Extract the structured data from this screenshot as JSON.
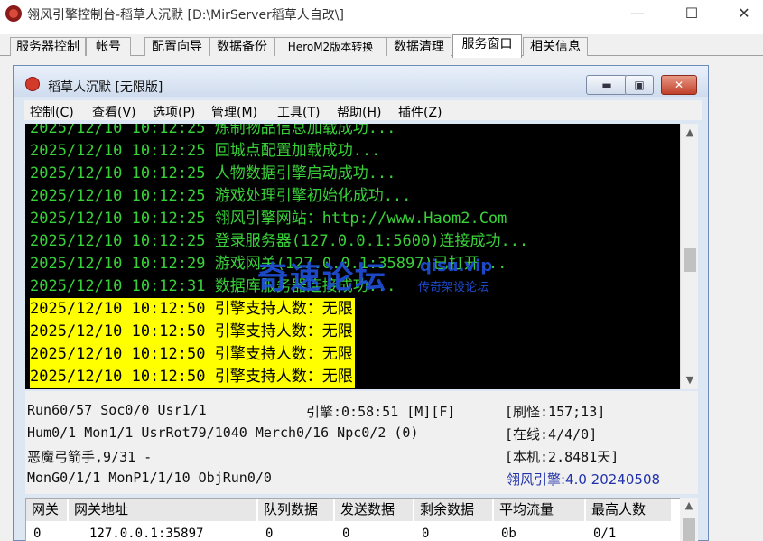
{
  "window": {
    "title": "翎风引擎控制台-稻草人沉默 [D:\\MirServer稻草人自改\\]",
    "minimize": "—",
    "maximize": "☐",
    "close": "✕"
  },
  "tabs": [
    {
      "label": "服务器控制"
    },
    {
      "label": "帐号"
    },
    {
      "label": "配置向导"
    },
    {
      "label": "数据备份"
    },
    {
      "label": "HeroM2版本转换"
    },
    {
      "label": "数据清理"
    },
    {
      "label": "服务窗口",
      "active": true
    },
    {
      "label": "相关信息"
    }
  ],
  "inner_window": {
    "title": "稻草人沉默 [无限版]",
    "minimize": "▬",
    "maximize": "▣",
    "close": "✕"
  },
  "menu": [
    "控制(C)",
    "查看(V)",
    "选项(P)",
    "管理(M)",
    "工具(T)",
    "帮助(H)",
    "插件(Z)"
  ],
  "log": [
    {
      "time": "2025/12/10 10:12:25",
      "msg": "炼制物品信息加载成功..."
    },
    {
      "time": "2025/12/10 10:12:25",
      "msg": "回城点配置加载成功..."
    },
    {
      "time": "2025/12/10 10:12:25",
      "msg": "人物数据引擎启动成功..."
    },
    {
      "time": "2025/12/10 10:12:25",
      "msg": "游戏处理引擎初始化成功..."
    },
    {
      "time": "2025/12/10 10:12:25",
      "msg": "翎风引擎网站：http://www.Haom2.Com"
    },
    {
      "time": "2025/12/10 10:12:25",
      "msg": "登录服务器(127.0.0.1:5600)连接成功..."
    },
    {
      "time": "2025/12/10 10:12:29",
      "msg": "游戏网关(127.0.0.1:35897)已打开..."
    },
    {
      "time": "2025/12/10 10:12:31",
      "msg": "数据库服务器连接成功..."
    },
    {
      "time": "2025/12/10 10:12:50",
      "msg": "引擎支持人数：无限",
      "highlight": true
    },
    {
      "time": "2025/12/10 10:12:50",
      "msg": "引擎支持人数：无限",
      "highlight": true
    },
    {
      "time": "2025/12/10 10:12:50",
      "msg": "引擎支持人数：无限",
      "highlight": true
    },
    {
      "time": "2025/12/10 10:12:50",
      "msg": "引擎支持人数：无限",
      "highlight": true
    }
  ],
  "status": {
    "line1_left": "Run60/57 Soc0/0 Usr1/1",
    "line1_mid": "引擎:0:58:51 [M][F]",
    "line1_right": "[刷怪:157;13]",
    "line2_left": "Hum0/1 Mon1/1 UsrRot79/1040 Merch0/16 Npc0/2 (0)",
    "line2_right": "[在线:4/4/0]",
    "line3_left": "恶魔弓箭手,9/31 -",
    "line3_right": "[本机:2.8481天]",
    "line4_left": "MonG0/1/1 MonP1/1/10 ObjRun0/0",
    "line4_right": "翎风引擎:4.0 20240508",
    "accent": "#2233aa"
  },
  "table": {
    "headers": [
      "网关",
      "网关地址",
      "队列数据",
      "发送数据",
      "剩余数据",
      "平均流量",
      "最高人数"
    ],
    "rows": [
      [
        "0",
        "127.0.0.1:35897",
        "0",
        "0",
        "0",
        "0b",
        "0/1"
      ]
    ]
  },
  "watermark": {
    "main": "奇速论坛",
    "url": "qisu.vip",
    "sub": "传奇架设论坛"
  },
  "colors": {
    "log_bg": "#000000",
    "log_text": "#39d139",
    "highlight_bg": "#ffff00"
  }
}
